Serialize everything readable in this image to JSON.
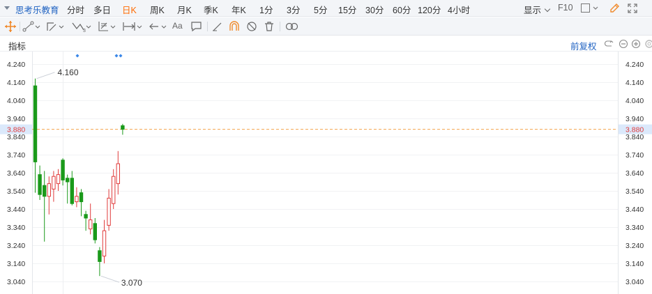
{
  "header": {
    "stock_name": "思考乐教育",
    "periods": [
      {
        "label": "分时",
        "active": false
      },
      {
        "label": "多日",
        "active": false
      },
      {
        "label": "日K",
        "active": true
      },
      {
        "label": "周K",
        "active": false
      },
      {
        "label": "月K",
        "active": false
      },
      {
        "label": "季K",
        "active": false
      },
      {
        "label": "年K",
        "active": false
      },
      {
        "label": "1分",
        "active": false
      },
      {
        "label": "3分",
        "active": false
      },
      {
        "label": "5分",
        "active": false
      },
      {
        "label": "15分",
        "active": false
      },
      {
        "label": "30分",
        "active": false
      },
      {
        "label": "60分",
        "active": false
      },
      {
        "label": "120分",
        "active": false
      },
      {
        "label": "4小时",
        "active": false
      }
    ],
    "display_label": "显示",
    "f10_label": "F10"
  },
  "indicator_bar": {
    "label": "指标",
    "adjust_label": "前复权"
  },
  "colors": {
    "up": "#e03b3b",
    "down": "#1a9a1a",
    "active_period": "#ff6a00",
    "link": "#1f62c2",
    "price_line": "#f4a24c",
    "current_price_text": "#e03b3b"
  },
  "chart_data": {
    "type": "candlestick",
    "y_axis_ticks": [
      "4.240",
      "4.140",
      "4.040",
      "3.940",
      "3.840",
      "3.740",
      "3.640",
      "3.540",
      "3.440",
      "3.340",
      "3.240",
      "3.140",
      "3.040"
    ],
    "current_price": "3.880",
    "high_annotation": "4.160",
    "low_annotation": "3.070",
    "y_range": [
      3.0,
      4.27
    ],
    "candles": [
      {
        "open": 4.12,
        "close": 3.7,
        "high": 4.16,
        "low": 3.53
      },
      {
        "open": 3.63,
        "close": 3.52,
        "high": 3.68,
        "low": 3.49
      },
      {
        "open": 3.57,
        "close": 3.51,
        "high": 3.65,
        "low": 3.26
      },
      {
        "open": 3.51,
        "close": 3.58,
        "high": 3.62,
        "low": 3.41
      },
      {
        "open": 3.55,
        "close": 3.62,
        "high": 3.65,
        "low": 3.48
      },
      {
        "open": 3.58,
        "close": 3.63,
        "high": 3.66,
        "low": 3.54
      },
      {
        "open": 3.71,
        "close": 3.6,
        "high": 3.72,
        "low": 3.57
      },
      {
        "open": 3.61,
        "close": 3.59,
        "high": 3.63,
        "low": 3.47
      },
      {
        "open": 3.61,
        "close": 3.47,
        "high": 3.65,
        "low": 3.46
      },
      {
        "open": 3.48,
        "close": 3.51,
        "high": 3.56,
        "low": 3.45
      },
      {
        "open": 3.53,
        "close": 3.48,
        "high": 3.55,
        "low": 3.4
      },
      {
        "open": 3.41,
        "close": 3.39,
        "high": 3.43,
        "low": 3.32
      },
      {
        "open": 3.33,
        "close": 3.38,
        "high": 3.47,
        "low": 3.3
      },
      {
        "open": 3.36,
        "close": 3.27,
        "high": 3.39,
        "low": 3.25
      },
      {
        "open": 3.21,
        "close": 3.15,
        "high": 3.23,
        "low": 3.07
      },
      {
        "open": 3.18,
        "close": 3.32,
        "high": 3.38,
        "low": 3.14
      },
      {
        "open": 3.35,
        "close": 3.5,
        "high": 3.55,
        "low": 3.32
      },
      {
        "open": 3.47,
        "close": 3.62,
        "high": 3.66,
        "low": 3.44
      },
      {
        "open": 3.58,
        "close": 3.69,
        "high": 3.76,
        "low": 3.52
      },
      {
        "open": 3.9,
        "close": 3.88,
        "high": 3.91,
        "low": 3.85
      }
    ]
  }
}
